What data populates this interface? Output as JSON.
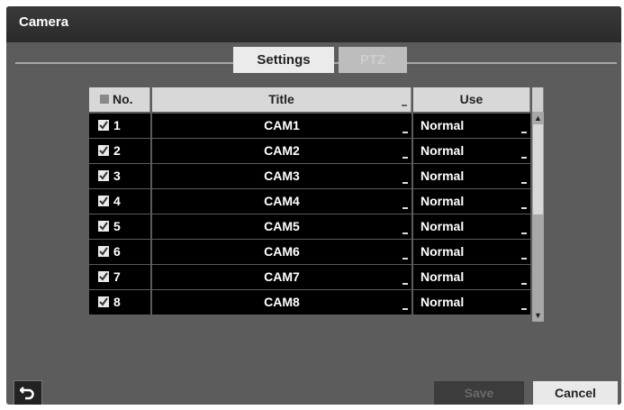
{
  "window": {
    "title": "Camera"
  },
  "tabs": [
    {
      "label": "Settings",
      "active": true
    },
    {
      "label": "PTZ",
      "active": false
    }
  ],
  "table": {
    "headers": {
      "no": "No.",
      "title": "Title",
      "use": "Use"
    },
    "rows": [
      {
        "no": "1",
        "title": "CAM1",
        "use": "Normal",
        "checked": true
      },
      {
        "no": "2",
        "title": "CAM2",
        "use": "Normal",
        "checked": true
      },
      {
        "no": "3",
        "title": "CAM3",
        "use": "Normal",
        "checked": true
      },
      {
        "no": "4",
        "title": "CAM4",
        "use": "Normal",
        "checked": true
      },
      {
        "no": "5",
        "title": "CAM5",
        "use": "Normal",
        "checked": true
      },
      {
        "no": "6",
        "title": "CAM6",
        "use": "Normal",
        "checked": true
      },
      {
        "no": "7",
        "title": "CAM7",
        "use": "Normal",
        "checked": true
      },
      {
        "no": "8",
        "title": "CAM8",
        "use": "Normal",
        "checked": true
      }
    ]
  },
  "buttons": {
    "save": "Save",
    "cancel": "Cancel"
  },
  "icons": {
    "back": "back-arrow-icon",
    "checkbox": "checkbox-icon",
    "scroll_up": "scroll-up-icon",
    "scroll_down": "scroll-down-icon"
  },
  "colors": {
    "window_bg": "#5c5c5c",
    "title_bar": "#2f2f2f",
    "cell_bg": "#000000",
    "header_bg": "#d8d8d8",
    "active_tab": "#ebebeb"
  }
}
